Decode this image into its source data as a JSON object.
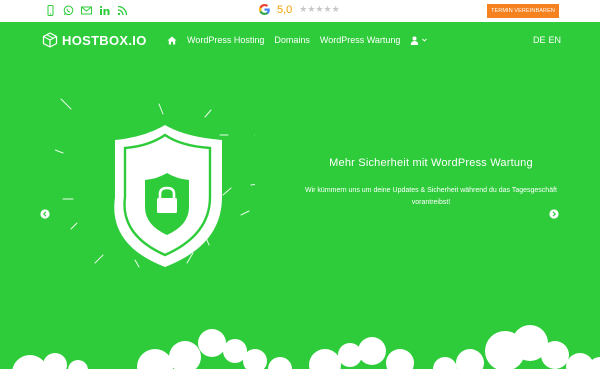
{
  "topbar": {
    "icons": [
      "phone-icon",
      "whatsapp-icon",
      "mail-icon",
      "linkedin-icon",
      "rss-icon"
    ],
    "rating": {
      "brand_letter": "G",
      "score": "5,0",
      "stars": "★★★★★"
    },
    "cta_label": "TERMIN VEREINBAREN"
  },
  "header": {
    "logo_text": "HOSTBOX.IO",
    "nav": {
      "home_icon": "home-icon",
      "items": [
        "WordPress Hosting",
        "Domains",
        "WordPress Wartung"
      ],
      "user_icon": "user-icon"
    },
    "languages": [
      "DE",
      "EN"
    ]
  },
  "hero": {
    "title": "Mehr Sicherheit mit WordPress Wartung",
    "subtitle": "Wir kümmern uns um deine Updates & Sicherheit während du das Tagesgeschäft vorantreibst!"
  },
  "colors": {
    "background": "#2ecc3a",
    "cta": "#f5821f",
    "icon": "#2ecc3a",
    "white": "#ffffff"
  }
}
